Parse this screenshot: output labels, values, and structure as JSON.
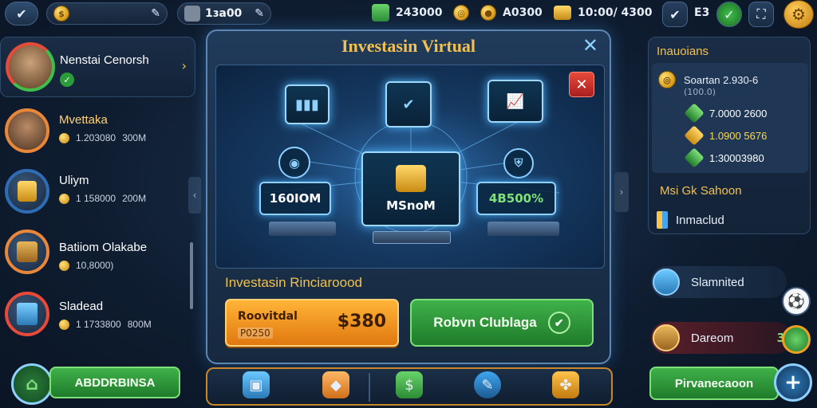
{
  "topbar": {
    "search_value": "",
    "player_level": "1ɜa00",
    "cash": "243000",
    "gold": "A0300",
    "resource": "10:00/ 4300",
    "badge_count": "E3"
  },
  "left_panel": {
    "player": {
      "name": "Nenstai Cenorsh",
      "status": "✓"
    },
    "items": [
      {
        "name": "Mvettaka",
        "stat_a": "1.203080",
        "stat_b": "300M"
      },
      {
        "name": "Uliym",
        "stat_a": "1 158000",
        "stat_b": "200M"
      },
      {
        "name": "Batiiom Olakabe",
        "stat_a": "10,8000)",
        "stat_b": ""
      },
      {
        "name": "Sladead",
        "stat_a": "1 1733800",
        "stat_b": "800M"
      }
    ],
    "bottom_button": "ABDDRBINSA"
  },
  "modal": {
    "title": "Investasin Virtual",
    "center_monitor_label": "MSnoM",
    "left_stat": "160IOM",
    "right_stat": "4B500%",
    "section_title": "Investasin Rinciaroood",
    "buy_button": {
      "label": "Roovitdal",
      "sub": "P0250",
      "price": "$380"
    },
    "confirm_button": "Robvn Clublaga"
  },
  "right_panel": {
    "title": "Inauoians",
    "rows": [
      {
        "label": "Soartan 2.930-6",
        "sub": "(100.0)"
      },
      {
        "label": "7.0000 2600",
        "color": "#ffffff"
      },
      {
        "label": "1.0900 5676",
        "color": "#ffd84a"
      },
      {
        "label": "1:30003980",
        "color": "#ffffff"
      }
    ],
    "footer_label": "Msi Gk Sahoon",
    "link_label": "Inmaclud"
  },
  "side_actions": {
    "item1": "Slamnited",
    "item2": "Dareom",
    "item2_badge": "3",
    "bottom_button": "Pirvanecaoon"
  },
  "colors": {
    "accent_gold": "#f2c14e",
    "accent_green": "#38a845",
    "accent_orange": "#f0a020",
    "close_red": "#d32f2f"
  }
}
